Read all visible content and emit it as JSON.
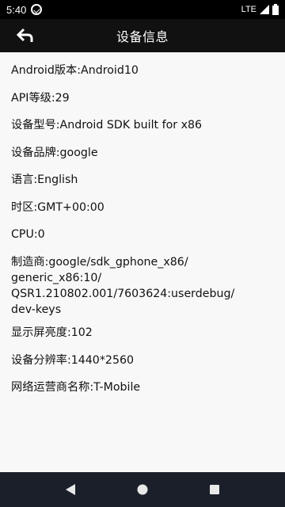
{
  "status_bar": {
    "time": "5:40",
    "network": "LTE",
    "icons": [
      "do-not-disturb-icon",
      "signal-icon",
      "battery-icon"
    ]
  },
  "app_bar": {
    "title": "设备信息",
    "back_icon": "back-arrow-icon"
  },
  "info": [
    "Android版本:Android10",
    "API等级:29",
    "设备型号:Android SDK built for x86",
    "设备品牌:google",
    "语言:English",
    "时区:GMT+00:00",
    "CPU:0",
    "制造商:google/sdk_gphone_x86/\ngeneric_x86:10/\nQSR1.210802.001/7603624:userdebug/\ndev-keys",
    "显示屏亮度:102",
    "设备分辨率:1440*2560",
    "网络运营商名称:T-Mobile"
  ],
  "nav_bar": {
    "buttons": [
      "back-triangle-icon",
      "home-circle-icon",
      "recents-square-icon"
    ]
  }
}
